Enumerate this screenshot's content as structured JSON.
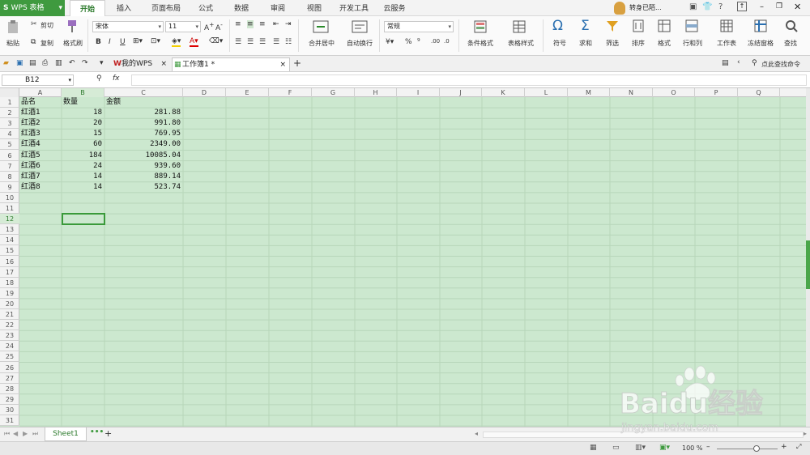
{
  "app": {
    "title": "WPS 表格",
    "user": "转身已陌..."
  },
  "ribbon_tabs": [
    {
      "label": "开始",
      "active": true
    },
    {
      "label": "插入",
      "active": false
    },
    {
      "label": "页面布局",
      "active": false
    },
    {
      "label": "公式",
      "active": false
    },
    {
      "label": "数据",
      "active": false
    },
    {
      "label": "审阅",
      "active": false
    },
    {
      "label": "视图",
      "active": false
    },
    {
      "label": "开发工具",
      "active": false
    },
    {
      "label": "云服务",
      "active": false
    }
  ],
  "toolbar": {
    "paste": "粘贴",
    "cut": "剪切",
    "copy": "复制",
    "format_painter": "格式刷",
    "font_name": "宋体",
    "font_size": "11",
    "merge_center": "合并居中",
    "wrap_text": "自动换行",
    "number_format": "常规",
    "percent": "%",
    "thousands": "⁹",
    "cond_format": "条件格式",
    "table_style": "表格样式",
    "symbol": "符号",
    "sum": "求和",
    "filter": "筛选",
    "sort": "排序",
    "format": "格式",
    "row_col": "行和列",
    "worksheet": "工作表",
    "freeze": "冻结窗格",
    "find": "查找"
  },
  "doc_tabs": [
    {
      "label": "我的WPS",
      "active": false
    },
    {
      "label": "工作簿1 *",
      "active": true
    }
  ],
  "search_command": "点此查找命令",
  "formula_bar": {
    "name_box": "B12",
    "fx": "fx",
    "content": ""
  },
  "columns": [
    "A",
    "B",
    "C",
    "D",
    "E",
    "F",
    "G",
    "H",
    "I",
    "J",
    "K",
    "L",
    "M",
    "N",
    "O",
    "P",
    "Q"
  ],
  "rows": [
    "1",
    "2",
    "3",
    "4",
    "5",
    "6",
    "7",
    "8",
    "9",
    "10",
    "11",
    "12",
    "13",
    "14",
    "15",
    "16",
    "17",
    "18",
    "19",
    "20",
    "21",
    "22",
    "23",
    "24",
    "25",
    "26",
    "27",
    "28",
    "29",
    "30",
    "31"
  ],
  "selected_cell": "B12",
  "sheet_data": {
    "headers": [
      "品名",
      "数量",
      "金额"
    ],
    "rows": [
      {
        "name": "红酒1",
        "qty": "18",
        "amount": "281.88"
      },
      {
        "name": "红酒2",
        "qty": "20",
        "amount": "991.80"
      },
      {
        "name": "红酒3",
        "qty": "15",
        "amount": "769.95"
      },
      {
        "name": "红酒4",
        "qty": "60",
        "amount": "2349.00"
      },
      {
        "name": "红酒5",
        "qty": "184",
        "amount": "10085.04"
      },
      {
        "name": "红酒6",
        "qty": "24",
        "amount": "939.60"
      },
      {
        "name": "红酒7",
        "qty": "14",
        "amount": "889.14"
      },
      {
        "name": "红酒8",
        "qty": "14",
        "amount": "523.74"
      }
    ]
  },
  "sheet_tabs": [
    {
      "label": "Sheet1",
      "active": true
    }
  ],
  "status": {
    "zoom": "100 %"
  },
  "watermark": {
    "brand": "Baidu经验",
    "url": "jingyan.baidu.com"
  },
  "colors": {
    "accent": "#3f9a3f",
    "grid_bg": "#cce8cf",
    "selection": "#3a9a3a"
  }
}
